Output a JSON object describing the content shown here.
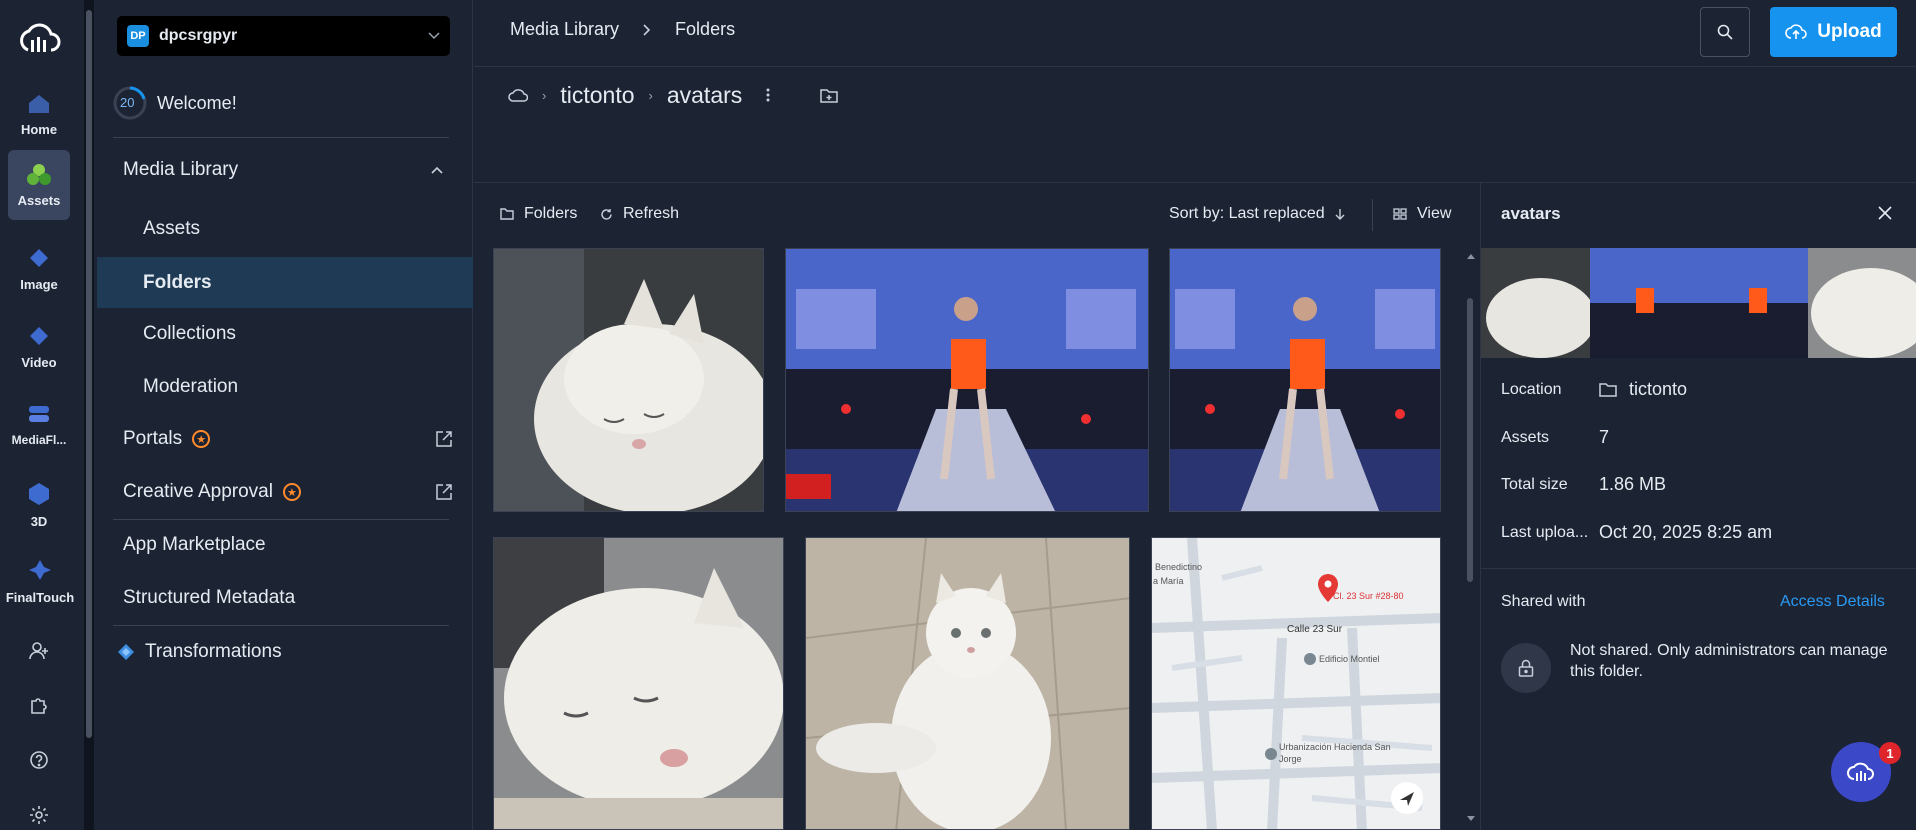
{
  "rail": {
    "items": [
      {
        "label": "Home",
        "icon": "home-icon"
      },
      {
        "label": "Assets",
        "icon": "assets-icon",
        "active": true
      },
      {
        "label": "Image",
        "icon": "image-icon"
      },
      {
        "label": "Video",
        "icon": "video-icon"
      },
      {
        "label": "MediaFl...",
        "icon": "mediaflows-icon"
      },
      {
        "label": "3D",
        "icon": "3d-icon"
      },
      {
        "label": "FinalTouch",
        "icon": "finaltouch-icon"
      }
    ],
    "bottom_icons": [
      "add-user-icon",
      "extensions-icon",
      "help-icon",
      "settings-icon"
    ]
  },
  "account": {
    "badge": "DP",
    "name": "dpcsrgpyr"
  },
  "welcome": {
    "progress": "20",
    "label": "Welcome!"
  },
  "nav": {
    "media_library": "Media Library",
    "assets": "Assets",
    "folders": "Folders",
    "collections": "Collections",
    "moderation": "Moderation",
    "portals": "Portals",
    "creative_approval": "Creative Approval",
    "app_marketplace": "App Marketplace",
    "structured_metadata": "Structured Metadata",
    "transformations": "Transformations"
  },
  "topbar": {
    "breadcrumb": [
      "Media Library",
      "Folders"
    ],
    "upload_label": "Upload"
  },
  "path": {
    "root": "tictonto",
    "current": "avatars"
  },
  "toolbar": {
    "folders": "Folders",
    "refresh": "Refresh",
    "sort": "Sort by: Last replaced",
    "view": "View"
  },
  "grid": {
    "items": [
      "white cat sleeping on blanket",
      "performer on stage in orange outfit",
      "performer on stage in orange outfit",
      "white cat lying on floor",
      "white cat sitting on tiled floor",
      "map location pin"
    ],
    "map": {
      "pin": "Cl. 23 Sur #28-80",
      "street": "Calle 23 Sur",
      "place1": "Edificio Montiel",
      "place2": "Urbanización Hacienda San Jorge",
      "corner1": "Benedictino",
      "corner2": "a María"
    }
  },
  "panel": {
    "title": "avatars",
    "location_label": "Location",
    "location_value": "tictonto",
    "assets_label": "Assets",
    "assets_value": "7",
    "size_label": "Total size",
    "size_value": "1.86 MB",
    "upload_label": "Last uploa...",
    "upload_value": "Oct 20, 2025 8:25 am",
    "shared_label": "Shared with",
    "access_link": "Access Details",
    "not_shared": "Not shared. Only administrators can manage this folder."
  },
  "fab": {
    "badge": "1"
  },
  "colors": {
    "accent": "#1693ef",
    "bg": "#1c2333",
    "star": "#ff8a2b",
    "selected": "#1e3a55"
  }
}
